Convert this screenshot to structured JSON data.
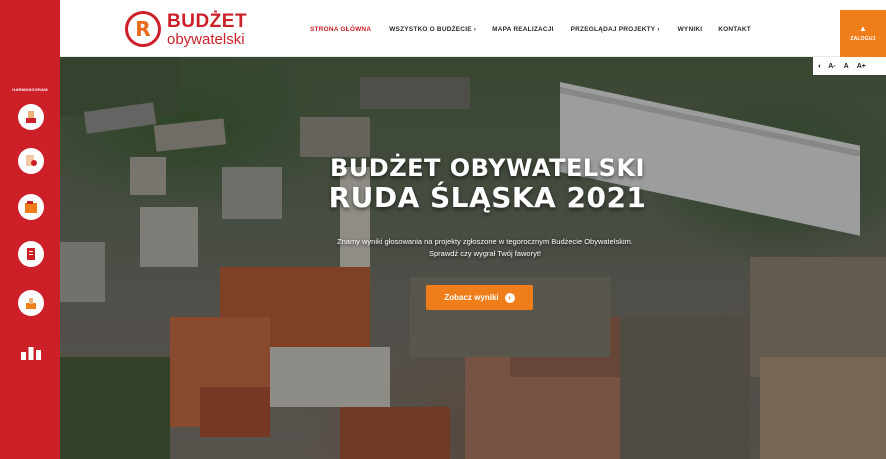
{
  "brand": {
    "title_line1": "BUDŻET",
    "title_line2": "obywatelski",
    "mark": "R",
    "primary_color": "#cc1f28",
    "accent_color": "#ef7d1a"
  },
  "nav": {
    "items": [
      {
        "label": "STRONA GŁÓWNA",
        "active": true
      },
      {
        "label": "WSZYSTKO O BUDŻECIE ›",
        "active": false
      },
      {
        "label": "MAPA REALIZACJI",
        "active": false
      },
      {
        "label": "PRZEGLĄDAJ PROJEKTY ›",
        "active": false
      },
      {
        "label": "WYNIKI",
        "active": false
      },
      {
        "label": "KONTAKT",
        "active": false
      }
    ]
  },
  "login": {
    "label": "ZALOGUJ",
    "icon": "user-icon"
  },
  "accessibility": {
    "contrast_icon": "contrast-icon",
    "font_small": "A-",
    "font_normal": "A",
    "font_large": "A+"
  },
  "sidebar": {
    "heading": "HARMONOGRAM",
    "items": [
      {
        "icon": "submit-project-icon"
      },
      {
        "icon": "verification-icon"
      },
      {
        "icon": "list-icon"
      },
      {
        "icon": "document-icon"
      },
      {
        "icon": "voting-icon"
      },
      {
        "icon": "results-icon"
      }
    ]
  },
  "hero": {
    "title_line1": "BUDŻET OBYWATELSKI",
    "title_line2": "RUDA ŚLĄSKA 2021",
    "subtitle_line1": "Znamy wyniki głosowania na projekty zgłoszone w tegorocznym Budżecie Obywatelskim.",
    "subtitle_line2": "Sprawdź czy wygrał Twój faworyt!",
    "cta_label": "Zobacz wyniki",
    "cta_icon": "arrow-right-icon"
  }
}
